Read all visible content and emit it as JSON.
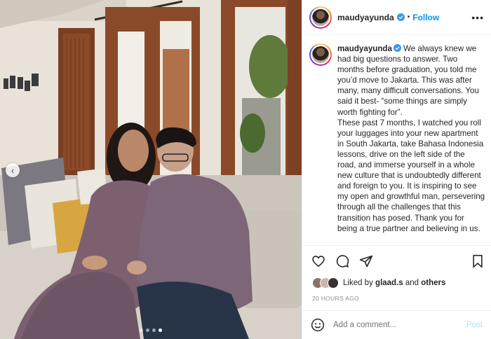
{
  "post": {
    "username": "maudyayunda",
    "follow_label": "Follow",
    "separator": "•",
    "more_label": "•••",
    "caption_p1": "We always knew we had big questions to answer. Two months before graduation, you told me you’d move to Jakarta. This was after many, many difficult conversations. You said it best- “some things are simply worth fighting for”.",
    "caption_p2": "These past 7 months, I watched you roll your luggages into your new apartment in South Jakarta, take Bahasa Indonesia lessons, drive on the left side of the road, and immerse yourself in a whole new culture that is undoubtedly different and foreign to you. It is inspiring to see my open and growthful man, persevering through all the challenges that this transition has posed. Thank you for being a true partner and believing in us.",
    "liked_prefix": "Liked by",
    "liked_user": "glaad.s",
    "liked_and": "and",
    "liked_others": "others",
    "time_ago": "20 HOURS AGO",
    "comment_placeholder": "Add a comment...",
    "post_label": "Post",
    "prev_arrow": "‹"
  },
  "carousel": {
    "count": 4,
    "active_index": 3
  },
  "colors": {
    "accent": "#0095f6",
    "verified": "#3897f0",
    "muted": "#8e8e8e",
    "post_disabled": "#b2dffc"
  },
  "icons": [
    "verified-icon",
    "more-icon",
    "heart-icon",
    "comment-icon",
    "share-icon",
    "bookmark-icon",
    "emoji-icon",
    "chevron-left-icon"
  ]
}
